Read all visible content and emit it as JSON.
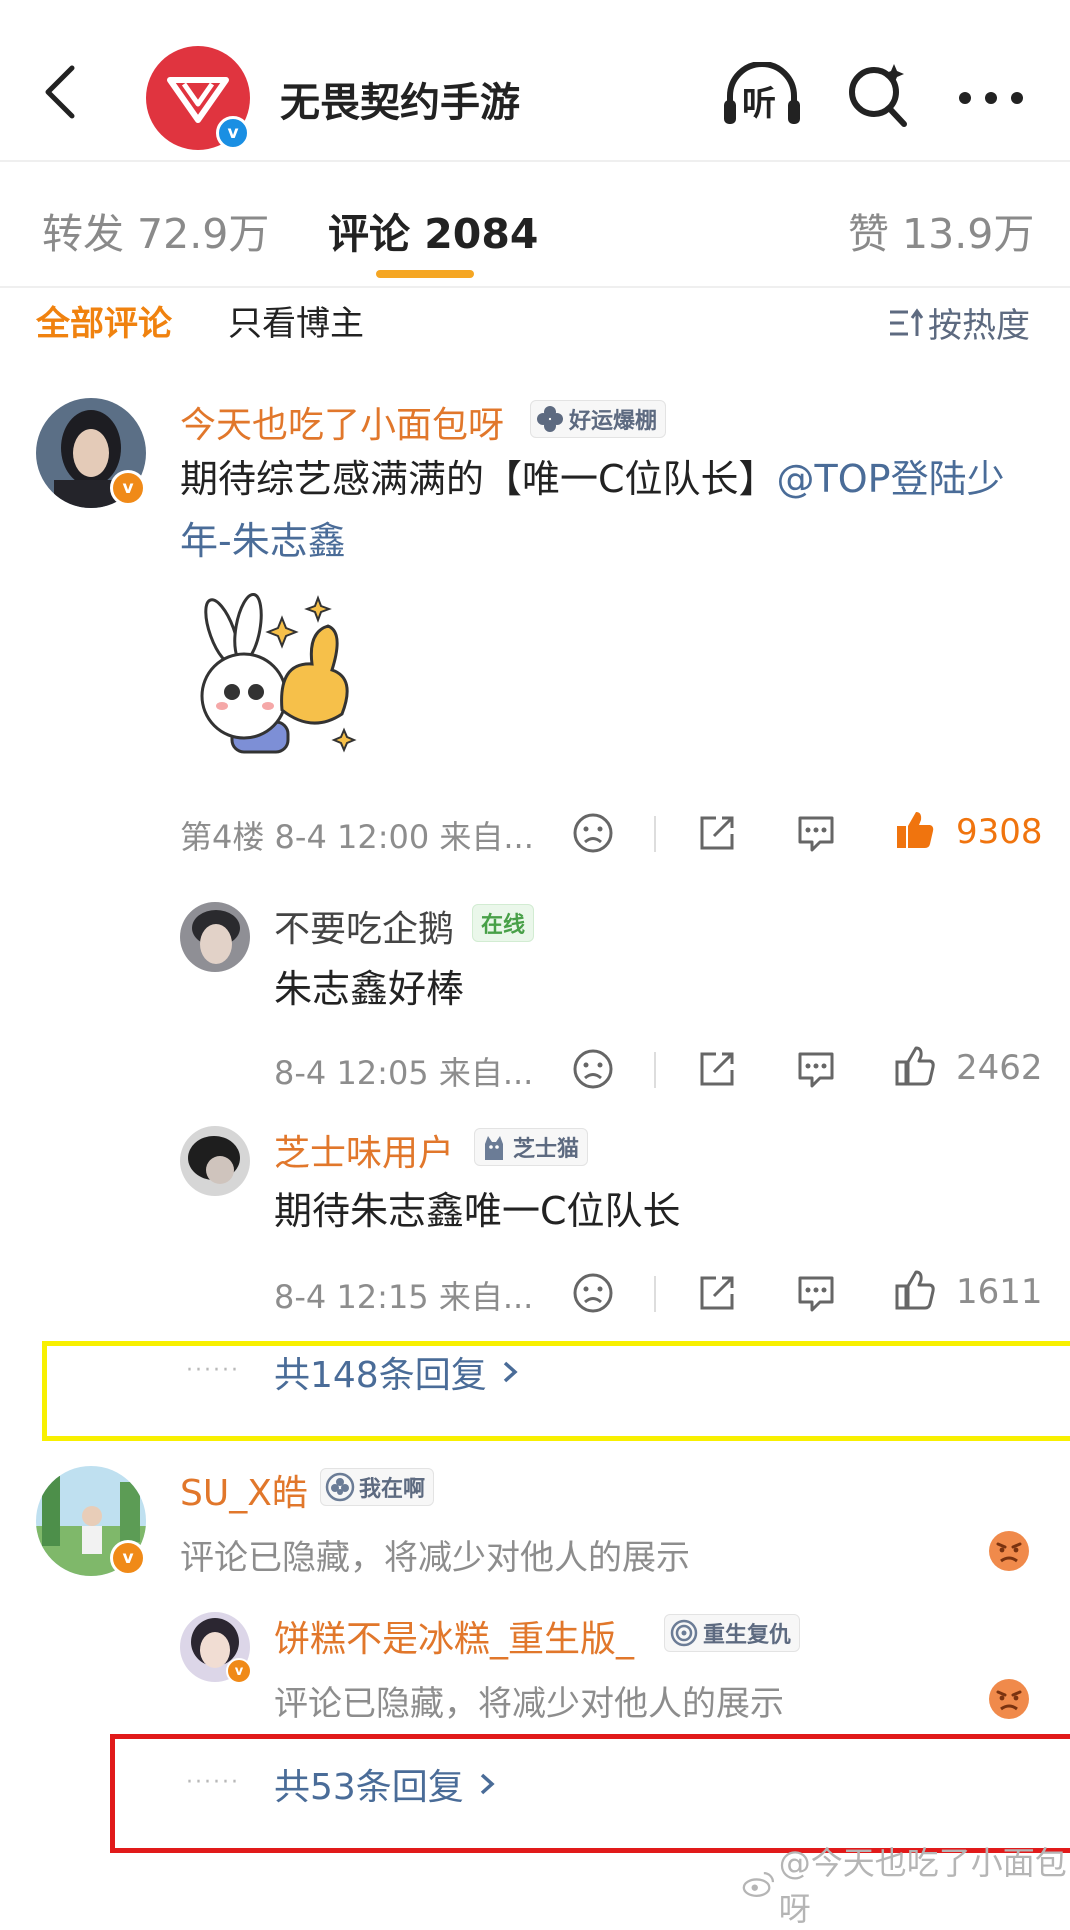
{
  "header": {
    "account_name": "无畏契约手游",
    "back_icon": "chevron-left-icon",
    "listen_label": "听",
    "search_icon": "ai-search-icon",
    "more_icon": "more-dots-icon"
  },
  "tabs": [
    {
      "label": "转发 72.9万"
    },
    {
      "label": "评论 2084"
    },
    {
      "label": "赞 13.9万"
    }
  ],
  "filters": {
    "all": "全部评论",
    "blogger": "只看博主",
    "sort": "按热度"
  },
  "comments": [
    {
      "user": "今天也吃了小面包呀",
      "badge": "好运爆棚",
      "text_main": "期待综艺感满满的【唯一C位队长】",
      "text_mention": "@TOP登陆少年-朱志鑫",
      "meta": "第4楼 8-4 12:00 来自...",
      "likes": "9308",
      "replies": [
        {
          "user": "不要吃企鹅",
          "badge": "在线",
          "text": "朱志鑫好棒",
          "meta": "8-4 12:05 来自...",
          "likes": "2462"
        },
        {
          "user": "芝士味用户",
          "badge": "芝士猫",
          "text": "期待朱志鑫唯一C位队长",
          "meta": "8-4 12:15 来自...",
          "likes": "1611"
        }
      ],
      "more_replies": "共148条回复"
    },
    {
      "user": "SU_X皓",
      "badge": "我在啊",
      "text": "评论已隐藏，将减少对他人的展示",
      "replies": [
        {
          "user": "饼糕不是冰糕_重生版_",
          "badge": "重生复仇",
          "text": "评论已隐藏，将减少对他人的展示"
        }
      ],
      "more_replies": "共53条回复"
    }
  ],
  "more_dots": "······",
  "watermark": "@今天也吃了小面包呀",
  "colors": {
    "accent_orange": "#f0820f",
    "link_blue": "#4a6c98",
    "highlight_yellow": "#f8f000",
    "highlight_red": "#e11a1a"
  }
}
